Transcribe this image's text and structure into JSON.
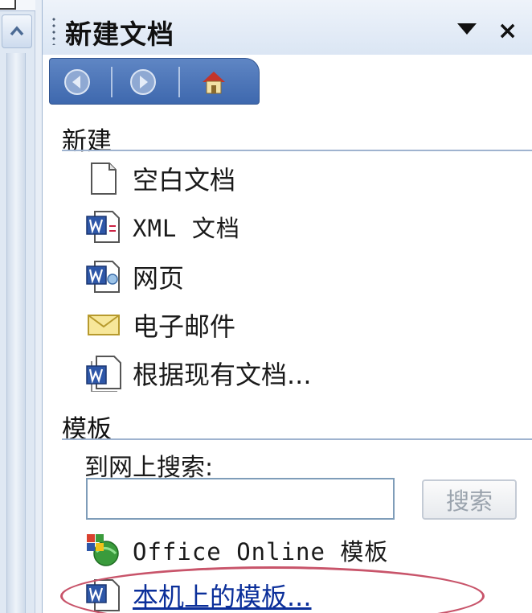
{
  "pane": {
    "title": "新建文档"
  },
  "sections": {
    "new_header": "新建",
    "templates_header": "模板"
  },
  "new_items": [
    {
      "label": "空白文档",
      "icon": "blank-document-icon"
    },
    {
      "label": "XML 文档",
      "icon": "xml-document-icon"
    },
    {
      "label": "网页",
      "icon": "web-page-icon"
    },
    {
      "label": "电子邮件",
      "icon": "email-envelope-icon"
    },
    {
      "label": "根据现有文档...",
      "icon": "existing-document-icon"
    }
  ],
  "template_search": {
    "label": "到网上搜索:",
    "value": "",
    "button_label": "搜索"
  },
  "template_items": [
    {
      "label": "Office Online 模板",
      "icon": "office-online-icon"
    },
    {
      "label": "本机上的模板...",
      "icon": "local-template-icon"
    }
  ],
  "colors": {
    "nav_bar": "#4a72b8",
    "link": "#0b2f9a",
    "highlight": "#c8546a"
  }
}
